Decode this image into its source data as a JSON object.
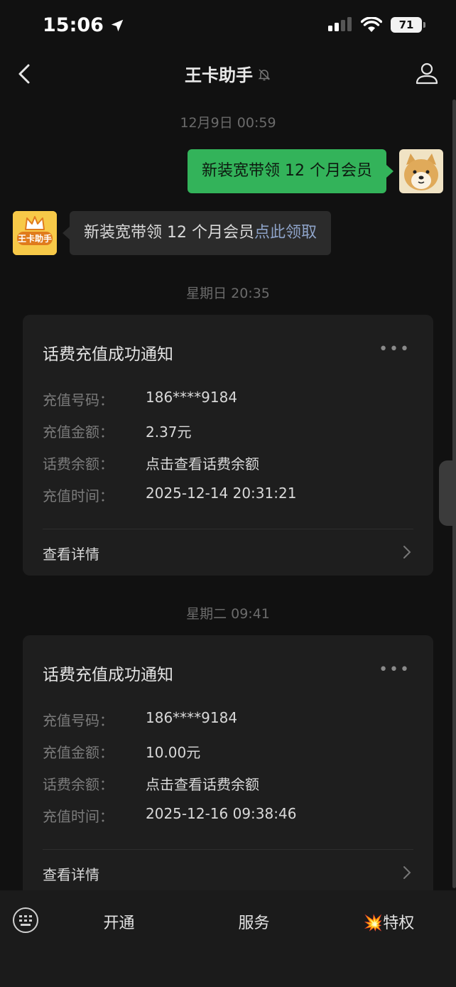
{
  "status": {
    "time": "15:06",
    "battery": "71"
  },
  "nav": {
    "title": "王卡助手",
    "back_icon": "chevron-left-icon",
    "profile_icon": "person-icon",
    "mute_icon": "bell-muted-icon"
  },
  "chat": {
    "timestamp1": "12月9日 00:59",
    "outgoing_text": "新装宽带领 12 个月会员",
    "incoming_text": "新装宽带领 12 个月会员",
    "incoming_link": "点此领取",
    "bot_avatar_text": "王卡助手",
    "timestamp2": "星期日 20:35",
    "timestamp3": "星期二 09:41"
  },
  "cards": [
    {
      "title": "话费充值成功通知",
      "rows": [
        {
          "k": "充值号码：",
          "v": "186****9184"
        },
        {
          "k": "充值金额：",
          "v": "2.37元"
        },
        {
          "k": "话费余额：",
          "v": "点击查看话费余额"
        },
        {
          "k": "充值时间：",
          "v": "2025-12-14 20:31:21"
        }
      ],
      "detail": "查看详情"
    },
    {
      "title": "话费充值成功通知",
      "rows": [
        {
          "k": "充值号码：",
          "v": "186****9184"
        },
        {
          "k": "充值金额：",
          "v": "10.00元"
        },
        {
          "k": "话费余额：",
          "v": "点击查看话费余额"
        },
        {
          "k": "充值时间：",
          "v": "2025-12-16 09:38:46"
        }
      ],
      "detail": "查看详情"
    }
  ],
  "bottom_menu": {
    "item1": "开通",
    "item2": "服务",
    "item3": "特权",
    "item3_icon": "💥",
    "keyboard_icon": "keyboard-icon"
  }
}
